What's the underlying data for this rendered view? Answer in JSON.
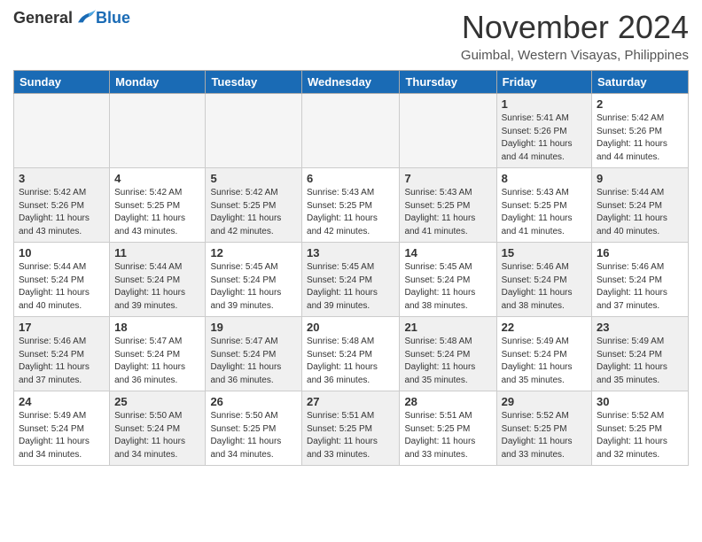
{
  "header": {
    "logo_general": "General",
    "logo_blue": "Blue",
    "month_title": "November 2024",
    "location": "Guimbal, Western Visayas, Philippines"
  },
  "days_of_week": [
    "Sunday",
    "Monday",
    "Tuesday",
    "Wednesday",
    "Thursday",
    "Friday",
    "Saturday"
  ],
  "weeks": [
    [
      {
        "day": "",
        "info": "",
        "empty": true
      },
      {
        "day": "",
        "info": "",
        "empty": true
      },
      {
        "day": "",
        "info": "",
        "empty": true
      },
      {
        "day": "",
        "info": "",
        "empty": true
      },
      {
        "day": "",
        "info": "",
        "empty": true
      },
      {
        "day": "1",
        "info": "Sunrise: 5:41 AM\nSunset: 5:26 PM\nDaylight: 11 hours\nand 44 minutes.",
        "empty": false,
        "shaded": true
      },
      {
        "day": "2",
        "info": "Sunrise: 5:42 AM\nSunset: 5:26 PM\nDaylight: 11 hours\nand 44 minutes.",
        "empty": false,
        "shaded": false
      }
    ],
    [
      {
        "day": "3",
        "info": "Sunrise: 5:42 AM\nSunset: 5:26 PM\nDaylight: 11 hours\nand 43 minutes.",
        "empty": false,
        "shaded": true
      },
      {
        "day": "4",
        "info": "Sunrise: 5:42 AM\nSunset: 5:25 PM\nDaylight: 11 hours\nand 43 minutes.",
        "empty": false,
        "shaded": false
      },
      {
        "day": "5",
        "info": "Sunrise: 5:42 AM\nSunset: 5:25 PM\nDaylight: 11 hours\nand 42 minutes.",
        "empty": false,
        "shaded": true
      },
      {
        "day": "6",
        "info": "Sunrise: 5:43 AM\nSunset: 5:25 PM\nDaylight: 11 hours\nand 42 minutes.",
        "empty": false,
        "shaded": false
      },
      {
        "day": "7",
        "info": "Sunrise: 5:43 AM\nSunset: 5:25 PM\nDaylight: 11 hours\nand 41 minutes.",
        "empty": false,
        "shaded": true
      },
      {
        "day": "8",
        "info": "Sunrise: 5:43 AM\nSunset: 5:25 PM\nDaylight: 11 hours\nand 41 minutes.",
        "empty": false,
        "shaded": false
      },
      {
        "day": "9",
        "info": "Sunrise: 5:44 AM\nSunset: 5:24 PM\nDaylight: 11 hours\nand 40 minutes.",
        "empty": false,
        "shaded": true
      }
    ],
    [
      {
        "day": "10",
        "info": "Sunrise: 5:44 AM\nSunset: 5:24 PM\nDaylight: 11 hours\nand 40 minutes.",
        "empty": false,
        "shaded": false
      },
      {
        "day": "11",
        "info": "Sunrise: 5:44 AM\nSunset: 5:24 PM\nDaylight: 11 hours\nand 39 minutes.",
        "empty": false,
        "shaded": true
      },
      {
        "day": "12",
        "info": "Sunrise: 5:45 AM\nSunset: 5:24 PM\nDaylight: 11 hours\nand 39 minutes.",
        "empty": false,
        "shaded": false
      },
      {
        "day": "13",
        "info": "Sunrise: 5:45 AM\nSunset: 5:24 PM\nDaylight: 11 hours\nand 39 minutes.",
        "empty": false,
        "shaded": true
      },
      {
        "day": "14",
        "info": "Sunrise: 5:45 AM\nSunset: 5:24 PM\nDaylight: 11 hours\nand 38 minutes.",
        "empty": false,
        "shaded": false
      },
      {
        "day": "15",
        "info": "Sunrise: 5:46 AM\nSunset: 5:24 PM\nDaylight: 11 hours\nand 38 minutes.",
        "empty": false,
        "shaded": true
      },
      {
        "day": "16",
        "info": "Sunrise: 5:46 AM\nSunset: 5:24 PM\nDaylight: 11 hours\nand 37 minutes.",
        "empty": false,
        "shaded": false
      }
    ],
    [
      {
        "day": "17",
        "info": "Sunrise: 5:46 AM\nSunset: 5:24 PM\nDaylight: 11 hours\nand 37 minutes.",
        "empty": false,
        "shaded": true
      },
      {
        "day": "18",
        "info": "Sunrise: 5:47 AM\nSunset: 5:24 PM\nDaylight: 11 hours\nand 36 minutes.",
        "empty": false,
        "shaded": false
      },
      {
        "day": "19",
        "info": "Sunrise: 5:47 AM\nSunset: 5:24 PM\nDaylight: 11 hours\nand 36 minutes.",
        "empty": false,
        "shaded": true
      },
      {
        "day": "20",
        "info": "Sunrise: 5:48 AM\nSunset: 5:24 PM\nDaylight: 11 hours\nand 36 minutes.",
        "empty": false,
        "shaded": false
      },
      {
        "day": "21",
        "info": "Sunrise: 5:48 AM\nSunset: 5:24 PM\nDaylight: 11 hours\nand 35 minutes.",
        "empty": false,
        "shaded": true
      },
      {
        "day": "22",
        "info": "Sunrise: 5:49 AM\nSunset: 5:24 PM\nDaylight: 11 hours\nand 35 minutes.",
        "empty": false,
        "shaded": false
      },
      {
        "day": "23",
        "info": "Sunrise: 5:49 AM\nSunset: 5:24 PM\nDaylight: 11 hours\nand 35 minutes.",
        "empty": false,
        "shaded": true
      }
    ],
    [
      {
        "day": "24",
        "info": "Sunrise: 5:49 AM\nSunset: 5:24 PM\nDaylight: 11 hours\nand 34 minutes.",
        "empty": false,
        "shaded": false
      },
      {
        "day": "25",
        "info": "Sunrise: 5:50 AM\nSunset: 5:24 PM\nDaylight: 11 hours\nand 34 minutes.",
        "empty": false,
        "shaded": true
      },
      {
        "day": "26",
        "info": "Sunrise: 5:50 AM\nSunset: 5:25 PM\nDaylight: 11 hours\nand 34 minutes.",
        "empty": false,
        "shaded": false
      },
      {
        "day": "27",
        "info": "Sunrise: 5:51 AM\nSunset: 5:25 PM\nDaylight: 11 hours\nand 33 minutes.",
        "empty": false,
        "shaded": true
      },
      {
        "day": "28",
        "info": "Sunrise: 5:51 AM\nSunset: 5:25 PM\nDaylight: 11 hours\nand 33 minutes.",
        "empty": false,
        "shaded": false
      },
      {
        "day": "29",
        "info": "Sunrise: 5:52 AM\nSunset: 5:25 PM\nDaylight: 11 hours\nand 33 minutes.",
        "empty": false,
        "shaded": true
      },
      {
        "day": "30",
        "info": "Sunrise: 5:52 AM\nSunset: 5:25 PM\nDaylight: 11 hours\nand 32 minutes.",
        "empty": false,
        "shaded": false
      }
    ]
  ]
}
